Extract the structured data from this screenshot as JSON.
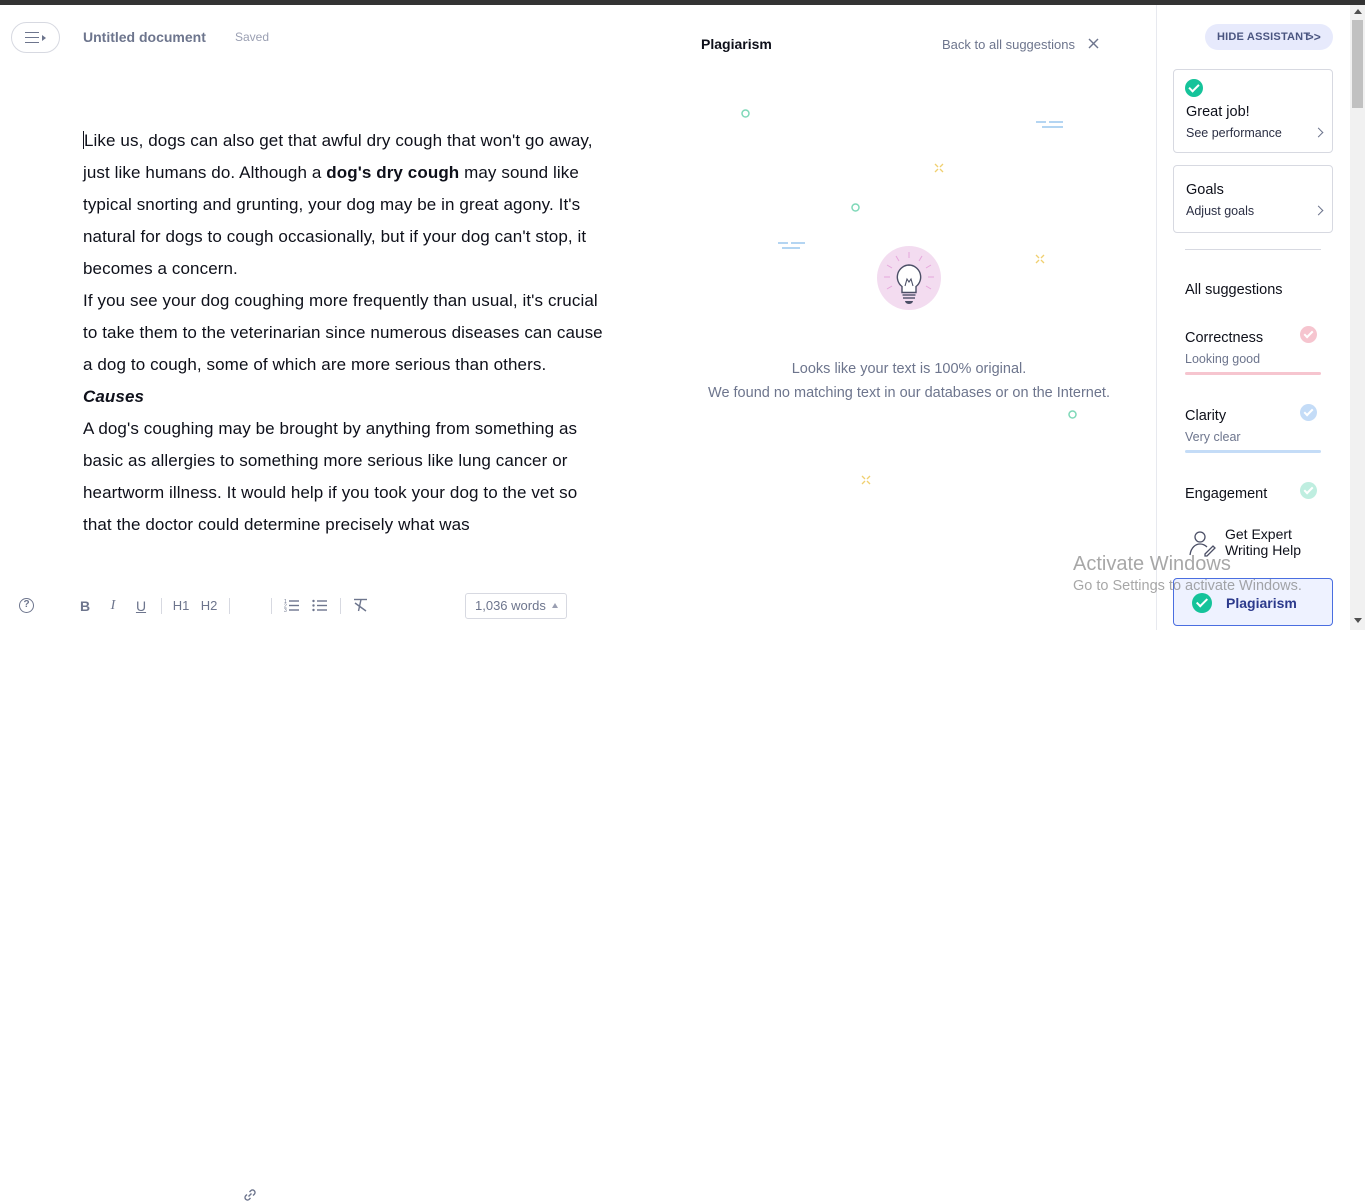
{
  "header": {
    "doc_title": "Untitled document",
    "status": "Saved"
  },
  "editor": {
    "paragraph1_a": "Like us, dogs can also get that awful dry cough that won't go away, just like humans do. Although a ",
    "paragraph1_bold": "dog's dry cough",
    "paragraph1_b": " may sound like typical snorting and grunting, your dog may be in great agony. It's natural for dogs to cough occasionally, but if your dog can't stop, it becomes a concern.",
    "paragraph2": "If you see your dog coughing more frequently than usual, it's crucial to take them to the veterinarian since numerous diseases can cause a dog to cough, some of which are more serious than others.",
    "heading": "Causes",
    "paragraph3": "A dog's coughing may be brought by anything from something as basic as allergies to something more serious like lung cancer or heartworm illness. It would help if you took your dog to the vet so that the doctor could determine precisely what was"
  },
  "toolbar": {
    "bold": "B",
    "italic": "I",
    "underline": "U",
    "h1": "H1",
    "h2": "H2",
    "help": "?",
    "word_count": "1,036 words"
  },
  "plagiarism": {
    "title": "Plagiarism",
    "back_link": "Back to all suggestions",
    "message_line1": "Looks like your text is 100% original.",
    "message_line2": "We found no matching text in our databases or on the Internet."
  },
  "sidebar": {
    "hide_button": "HIDE ASSISTANT",
    "hide_chevron": ">>",
    "performance_card": {
      "title": "Great job!",
      "subtitle": "See performance"
    },
    "goals_card": {
      "title": "Goals",
      "subtitle": "Adjust goals"
    },
    "all_suggestions": "All suggestions",
    "metrics": [
      {
        "name": "Correctness",
        "value": "Looking good",
        "color": "#f6c5cf"
      },
      {
        "name": "Clarity",
        "value": "Very clear",
        "color": "#c4dcf7"
      },
      {
        "name": "Engagement",
        "value": "",
        "color": "#bfeee0"
      }
    ],
    "expert": "Get Expert Writing Help",
    "plagiarism_button": "Plagiarism"
  },
  "watermark": {
    "line1": "Activate Windows",
    "line2": "Go to Settings to activate Windows."
  }
}
